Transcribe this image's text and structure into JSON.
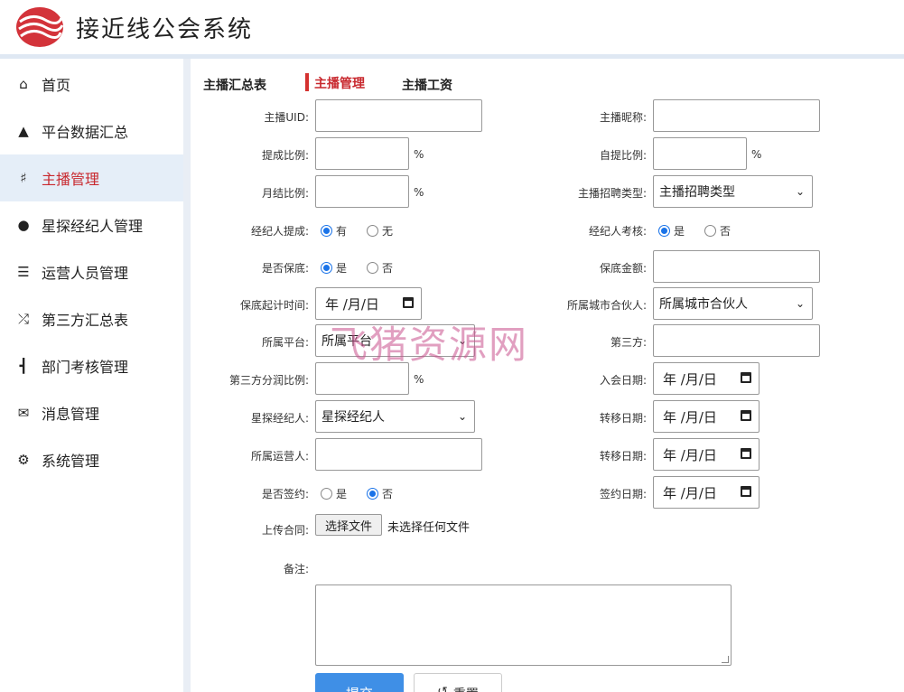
{
  "app": {
    "title": "接近线公会系统",
    "brand_color": "#c8282e"
  },
  "sidebar": {
    "items": [
      {
        "label": "首页",
        "icon": "home-icon",
        "active": false
      },
      {
        "label": "平台数据汇总",
        "icon": "dashboard-icon",
        "active": false
      },
      {
        "label": "主播管理",
        "icon": "anchor-icon",
        "active": true
      },
      {
        "label": "星探经纪人管理",
        "icon": "users-icon",
        "active": false
      },
      {
        "label": "运营人员管理",
        "icon": "list-icon",
        "active": false
      },
      {
        "label": "第三方汇总表",
        "icon": "shuffle-icon",
        "active": false
      },
      {
        "label": "部门考核管理",
        "icon": "org-icon",
        "active": false
      },
      {
        "label": "消息管理",
        "icon": "mail-icon",
        "active": false
      },
      {
        "label": "系统管理",
        "icon": "gear-icon",
        "active": false
      }
    ]
  },
  "tabs": [
    {
      "label": "主播汇总表",
      "active": false
    },
    {
      "label": "主播管理",
      "active": true
    },
    {
      "label": "主播工资",
      "active": false
    }
  ],
  "form": {
    "uid_label": "主播UID:",
    "nickname_label": "主播昵称:",
    "commission_label": "提成比例:",
    "self_commission_label": "自提比例:",
    "monthly_label": "月结比例:",
    "recruit_type_label": "主播招聘类型:",
    "recruit_type_value": "主播招聘类型",
    "agent_commission_label": "经纪人提成:",
    "agent_commission_yes": "有",
    "agent_commission_no": "无",
    "agent_review_label": "经纪人考核:",
    "agent_review_yes": "是",
    "agent_review_no": "否",
    "guarantee_label": "是否保底:",
    "guarantee_yes": "是",
    "guarantee_no": "否",
    "guarantee_amount_label": "保底金额:",
    "guarantee_start_label": "保底起计时间:",
    "city_partner_label": "所属城市合伙人:",
    "city_partner_value": "所属城市合伙人",
    "platform_label": "所属平台:",
    "platform_value": "所属平台",
    "third_party_label": "第三方:",
    "third_share_label": "第三方分润比例:",
    "join_date_label": "入会日期:",
    "scout_label": "星探经纪人:",
    "scout_value": "星探经纪人",
    "transfer_date_label": "转移日期:",
    "operator_label": "所属运营人:",
    "transfer_date2_label": "转移日期:",
    "signed_label": "是否签约:",
    "signed_yes": "是",
    "signed_no": "否",
    "sign_date_label": "签约日期:",
    "upload_label": "上传合同:",
    "upload_button": "选择文件",
    "upload_status": "未选择任何文件",
    "notes_label": "备注:",
    "percent": "%",
    "date_placeholder": "年 /月/日",
    "submit": "提交",
    "reset": "重置"
  },
  "watermark": "飞猪资源网"
}
